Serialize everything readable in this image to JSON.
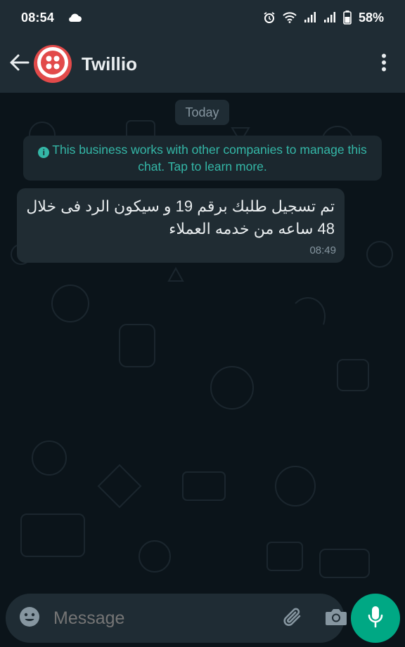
{
  "status_bar": {
    "time": "08:54",
    "battery": "58%",
    "icons": [
      "cloud-icon",
      "alarm-icon",
      "wifi-icon",
      "signal-icon",
      "signal-icon",
      "battery-icon"
    ]
  },
  "header": {
    "contact_name": "Twillio",
    "icons": [
      "back-arrow-icon",
      "twilio-logo-icon",
      "more-vert-icon"
    ]
  },
  "chat": {
    "date_chip": "Today",
    "system_notice": "This business works with other companies to manage this chat. Tap to learn more.",
    "messages": [
      {
        "direction": "incoming",
        "text_line1": "تم تسجيل طلبك برقم 19 و سيكون الرد فى خلال",
        "text_line2": "48 ساعه من خدمه العملاء",
        "time": "08:49"
      }
    ]
  },
  "input_bar": {
    "placeholder": "Message",
    "icons": [
      "emoji-icon",
      "attach-icon",
      "camera-icon",
      "mic-icon"
    ]
  },
  "colors": {
    "background": "#0b141a",
    "header": "#1f2c34",
    "bubble": "#202c33",
    "accent": "#00a884",
    "notice_text": "#34b7a7",
    "muted_text": "#8696a0"
  }
}
